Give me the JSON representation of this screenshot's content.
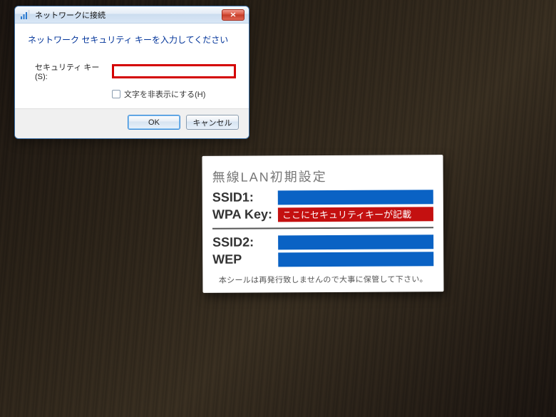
{
  "dialog": {
    "title": "ネットワークに接続",
    "instruction": "ネットワーク セキュリティ キーを入力してください",
    "field_label": "セキュリティ キー(S):",
    "security_value": "",
    "checkbox_label": "文字を非表示にする(H)",
    "ok_label": "OK",
    "cancel_label": "キャンセル"
  },
  "sticker": {
    "heading": "無線LAN初期設定",
    "ssid1_label": "SSID1:",
    "wpa_label": "WPA Key:",
    "wpa_annotation": "ここにセキュリティキーが記載",
    "ssid2_label": "SSID2:",
    "wep_label": "WEP",
    "footer": "本シールは再発行致しませんので大事に保管して下さい。"
  }
}
